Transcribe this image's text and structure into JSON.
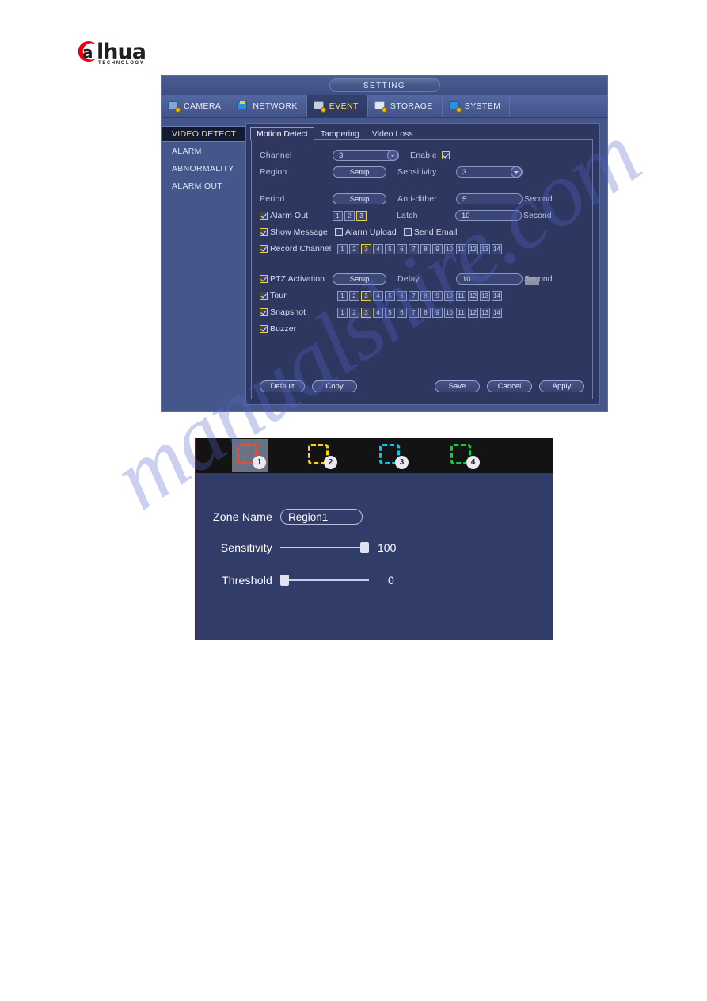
{
  "brand": {
    "name": "alhua",
    "tagline": "TECHNOLOGY",
    "mark": "a"
  },
  "watermark": {
    "text": "manualshire.com"
  },
  "window": {
    "title": "SETTING",
    "top_tabs": [
      {
        "label": "CAMERA",
        "icon": "camera-icon",
        "active": false,
        "color": "#8fb6e0"
      },
      {
        "label": "NETWORK",
        "icon": "network-icon",
        "active": false,
        "color": "#4f9fe0"
      },
      {
        "label": "EVENT",
        "icon": "event-icon",
        "active": true,
        "color": "#cfd6e8"
      },
      {
        "label": "STORAGE",
        "icon": "storage-icon",
        "active": false,
        "color": "#dfe6f3"
      },
      {
        "label": "SYSTEM",
        "icon": "system-icon",
        "active": false,
        "color": "#4f9fe0"
      }
    ],
    "sidebar": [
      {
        "label": "VIDEO DETECT",
        "active": true
      },
      {
        "label": "ALARM",
        "active": false
      },
      {
        "label": "ABNORMALITY",
        "active": false
      },
      {
        "label": "ALARM OUT",
        "active": false
      }
    ],
    "sub_tabs": [
      {
        "label": "Motion Detect",
        "active": true
      },
      {
        "label": "Tampering",
        "active": false
      },
      {
        "label": "Video Loss",
        "active": false
      }
    ],
    "form": {
      "channel_label": "Channel",
      "channel_value": "3",
      "enable_label": "Enable",
      "enable_checked": true,
      "region_label": "Region",
      "region_button": "Setup",
      "sensitivity_label": "Sensitivity",
      "sensitivity_value": "3",
      "period_label": "Period",
      "period_button": "Setup",
      "antidither_label": "Anti-dither",
      "antidither_value": "5",
      "antidither_unit": "Second",
      "alarm_out_label": "Alarm Out",
      "alarm_out_checked": true,
      "alarm_out_channels": [
        "1",
        "2",
        "3"
      ],
      "alarm_out_selected": [
        "3"
      ],
      "latch_label": "Latch",
      "latch_value": "10",
      "latch_unit": "Second",
      "show_message_label": "Show Message",
      "show_message_checked": true,
      "alarm_upload_label": "Alarm Upload",
      "alarm_upload_checked": false,
      "send_email_label": "Send Email",
      "send_email_checked": false,
      "record_channel_label": "Record Channel",
      "record_channel_checked": true,
      "record_channels": [
        "1",
        "2",
        "3",
        "4",
        "5",
        "6",
        "7",
        "8",
        "9",
        "10",
        "11",
        "12",
        "13",
        "14"
      ],
      "record_selected": [
        "3"
      ],
      "ptz_label": "PTZ Activation",
      "ptz_checked": true,
      "ptz_button": "Setup",
      "delay_label": "Delay",
      "delay_value": "10",
      "delay_unit": "Second",
      "tour_label": "Tour",
      "tour_checked": true,
      "tour_channels": [
        "1",
        "2",
        "3",
        "4",
        "5",
        "6",
        "7",
        "8",
        "9",
        "10",
        "11",
        "12",
        "13",
        "14"
      ],
      "tour_selected": [
        "3"
      ],
      "snapshot_label": "Snapshot",
      "snapshot_checked": true,
      "snapshot_channels": [
        "1",
        "2",
        "3",
        "4",
        "5",
        "6",
        "7",
        "8",
        "9",
        "10",
        "11",
        "12",
        "13",
        "14"
      ],
      "snapshot_selected": [
        "3"
      ],
      "buzzer_label": "Buzzer",
      "buzzer_checked": true
    },
    "buttons": {
      "default": "Default",
      "copy": "Copy",
      "save": "Save",
      "cancel": "Cancel",
      "apply": "Apply"
    }
  },
  "region_dialog": {
    "zones": [
      {
        "number": "1",
        "color": "#ff4a18",
        "selected": true
      },
      {
        "number": "2",
        "color": "#ffd400",
        "selected": false
      },
      {
        "number": "3",
        "color": "#00c8f0",
        "selected": false
      },
      {
        "number": "4",
        "color": "#00d43a",
        "selected": false
      }
    ],
    "zone_name_label": "Zone Name",
    "zone_name_value": "Region1",
    "sensitivity_label": "Sensitivity",
    "sensitivity_value": "100",
    "sensitivity_percent": 100,
    "threshold_label": "Threshold",
    "threshold_value": "0",
    "threshold_percent": 0
  },
  "colors": {
    "accent_yellow": "#ffe14d",
    "panel_bg": "#2e3760",
    "frame_bg": "#44568a",
    "dialog_bg": "#323c68",
    "watermark": "#5566cc"
  }
}
